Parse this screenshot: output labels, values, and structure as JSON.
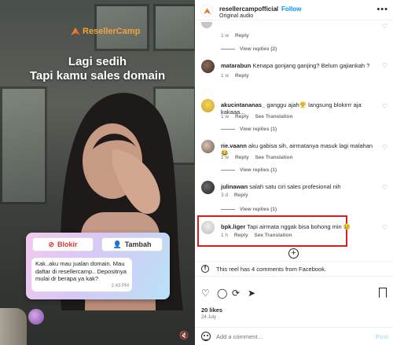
{
  "video": {
    "brand": "ResellerCamp",
    "caption_line1": "Lagi sedih",
    "caption_line2": "Tapi kamu sales domain",
    "chat": {
      "block_label": "Blokir",
      "add_label": "Tambah",
      "message": "Kak..aku mau jualan domain. Mau daftar di resellercamp.. Depositnya mulai dr berapa ya kak?",
      "time": "2.43 PM"
    }
  },
  "header": {
    "username": "resellercampofficial",
    "separator": "•",
    "follow_label": "Follow",
    "audio": "Original audio",
    "more": "•••"
  },
  "comments": [
    {
      "meta_time": "1 w",
      "reply_label": "Reply",
      "view_replies": "View replies (2)"
    },
    {
      "username": "matarabun",
      "text": "Kenapa gonjang ganjing? Belum gajiankah ?",
      "meta_time": "1 w",
      "reply_label": "Reply"
    },
    {
      "username": "akucintananas_",
      "text": "ganggu ajah😤 langsung blokirrr aja kakaaa...",
      "meta_time": "1 w",
      "reply_label": "Reply",
      "see_translation": "See Translation",
      "view_replies": "View replies (1)"
    },
    {
      "username": "rie.vaann",
      "text": "aku gabisa sih, airmatanya masuk lagi malahan😂",
      "meta_time": "1 w",
      "reply_label": "Reply",
      "see_translation": "See Translation",
      "view_replies": "View replies (1)"
    },
    {
      "username": "julinawan",
      "text": "salah satu ciri sales profesional nih",
      "meta_time": "3 d",
      "reply_label": "Reply",
      "view_replies": "View replies (1)"
    },
    {
      "username": "bpk.liger",
      "text": "Tapi airmata nggak bisa bohong min 😢",
      "meta_time": "1 h",
      "reply_label": "Reply",
      "see_translation": "See Translation"
    }
  ],
  "facebook_note": "This reel has 4 comments from Facebook.",
  "likes": "20 likes",
  "date": "24 July",
  "composer": {
    "placeholder": "Add a comment…",
    "post_label": "Post"
  }
}
